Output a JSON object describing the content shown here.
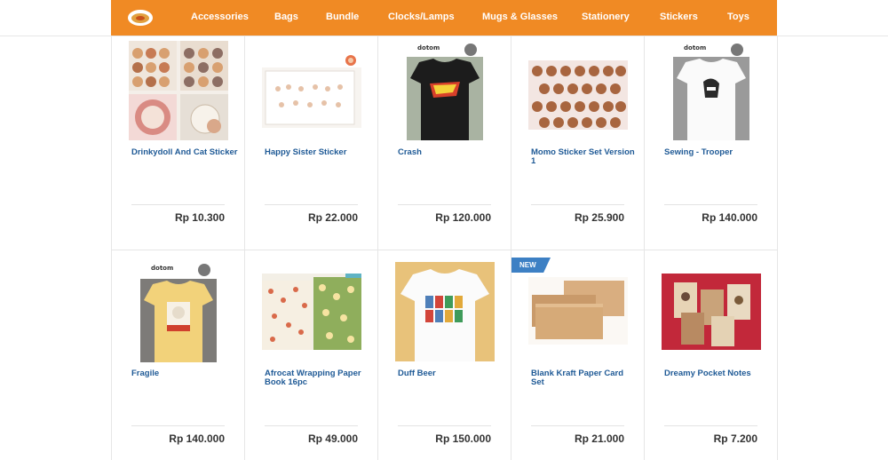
{
  "nav": {
    "items": [
      "Accessories",
      "Bags",
      "Bundle",
      "Clocks/Lamps",
      "Mugs & Glasses",
      "Stationery",
      "Stickers",
      "Toys"
    ]
  },
  "products": [
    {
      "title": "Drinkydoll And Cat Sticker",
      "price": "Rp 10.300",
      "image": "sticker-sheets-photo"
    },
    {
      "title": "Happy Sister Sticker",
      "price": "Rp 22.000",
      "image": "sticker-sheet-photo"
    },
    {
      "title": "Crash",
      "price": "Rp 120.000",
      "image": "black-tshirt-photo",
      "brand": "dotom"
    },
    {
      "title": "Momo Sticker Set Version 1",
      "price": "Rp 25.900",
      "image": "sticker-set-photo"
    },
    {
      "title": "Sewing - Trooper",
      "price": "Rp 140.000",
      "image": "white-tshirt-photo",
      "brand": "dotom"
    },
    {
      "title": "Fragile",
      "price": "Rp 140.000",
      "image": "yellow-tshirt-photo",
      "brand": "dotom"
    },
    {
      "title": "Afrocat Wrapping Paper Book 16pc",
      "price": "Rp 49.000",
      "image": "wrapping-paper-photo"
    },
    {
      "title": "Duff Beer",
      "price": "Rp 150.000",
      "image": "white-tshirt-cans-photo"
    },
    {
      "title": "Blank Kraft Paper Card Set",
      "price": "Rp 21.000",
      "image": "kraft-cards-photo",
      "badge": "NEW"
    },
    {
      "title": "Dreamy Pocket Notes",
      "price": "Rp 7.200",
      "image": "pocket-notes-photo"
    }
  ],
  "colors": {
    "nav_bg": "#f08a24",
    "title": "#1f5a96",
    "badge": "#3d80c4"
  }
}
